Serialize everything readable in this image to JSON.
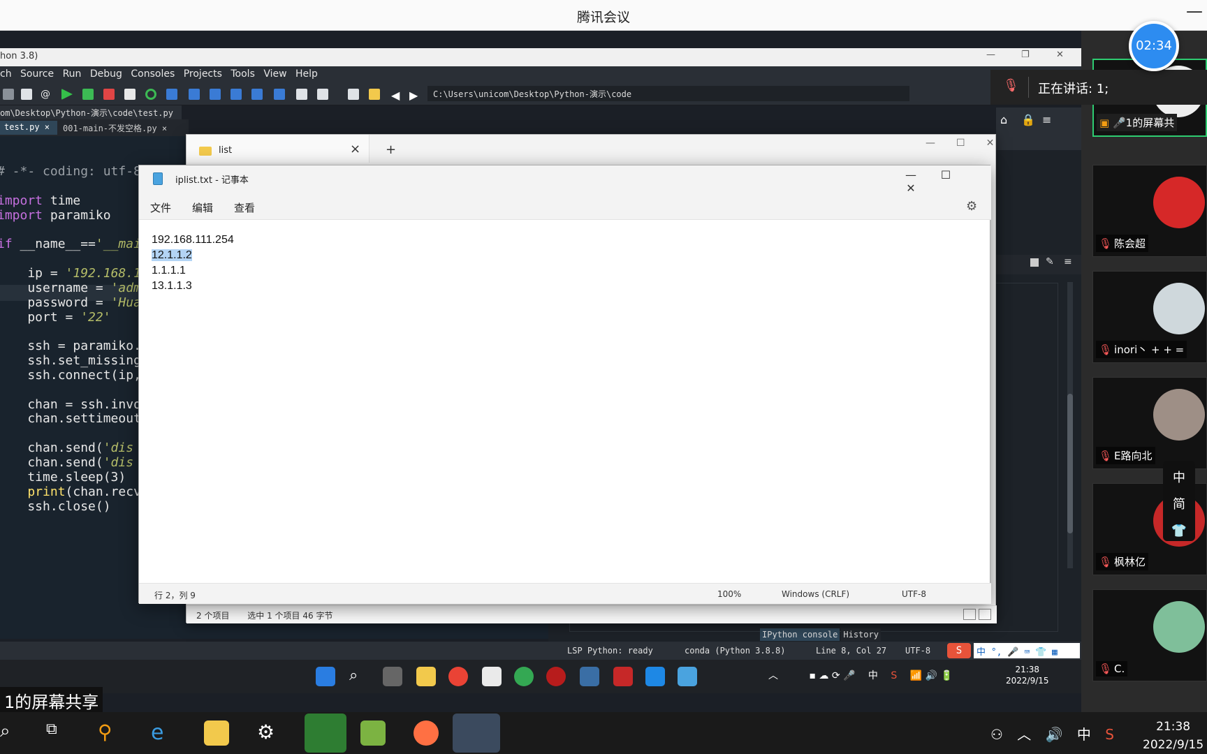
{
  "meeting": {
    "title": "腾讯会议",
    "minimize": "—",
    "timer": "02:34",
    "speaking": "正在讲话: 1;",
    "share_caption": "1的屏幕共享",
    "self_tile_label": "1的屏幕共"
  },
  "participants": [
    {
      "name": "陈会超",
      "avatar_color": "#d62828"
    },
    {
      "name": "inori丶 + + =",
      "avatar_color": "#cfd8dc"
    },
    {
      "name": "E路向北",
      "avatar_color": "#9e8f86"
    },
    {
      "name": "枫林亿",
      "avatar_color": "#c62828"
    },
    {
      "name": "C.",
      "avatar_color": "#7fbf9a"
    }
  ],
  "ime_palette": [
    "中",
    "简",
    "👕"
  ],
  "spyder": {
    "title": "hon 3.8)",
    "menu": [
      "ch",
      "Source",
      "Run",
      "Debug",
      "Consoles",
      "Projects",
      "Tools",
      "View",
      "Help"
    ],
    "path": "C:\\Users\\unicom\\Desktop\\Python-演示\\code",
    "filepath": "om\\Desktop\\Python-演示\\code\\test.py",
    "tabs": [
      "test.py ×",
      "001-main-不发空格.py ×"
    ],
    "code": [
      {
        "text": "# -*- coding: utf-8",
        "cls": "com"
      },
      {
        "text": "",
        "cls": ""
      },
      {
        "text": "import time",
        "cls": "kwline"
      },
      {
        "text": "import paramiko",
        "cls": "kwline"
      },
      {
        "text": "",
        "cls": ""
      },
      {
        "text": "if __name__=='__mai",
        "cls": "ifline"
      },
      {
        "text": "",
        "cls": ""
      },
      {
        "text": "    ip = '192.168.1",
        "cls": "strline"
      },
      {
        "text": "    username = 'adm",
        "cls": "strline"
      },
      {
        "text": "    password = 'Hua",
        "cls": "strline"
      },
      {
        "text": "    port = '22'",
        "cls": "strline"
      },
      {
        "text": "",
        "cls": ""
      },
      {
        "text": "    ssh = paramiko.",
        "cls": ""
      },
      {
        "text": "    ssh.set_missing",
        "cls": ""
      },
      {
        "text": "    ssh.connect(ip,",
        "cls": ""
      },
      {
        "text": "",
        "cls": ""
      },
      {
        "text": "    chan = ssh.invo",
        "cls": ""
      },
      {
        "text": "    chan.settimeout",
        "cls": ""
      },
      {
        "text": "",
        "cls": ""
      },
      {
        "text": "    chan.send('dis",
        "cls": "strline"
      },
      {
        "text": "    chan.send('dis",
        "cls": "strline"
      },
      {
        "text": "    time.sleep(3)",
        "cls": ""
      },
      {
        "text": "    print(chan.recv",
        "cls": "printline"
      },
      {
        "text": "    ssh.close()",
        "cls": ""
      }
    ],
    "console_tabs": [
      "IPython console",
      "History"
    ],
    "status": {
      "lsp": "LSP Python: ready",
      "conda": "conda (Python 3.8.8)",
      "pos": "Line 8, Col 27",
      "enc": "UTF-8"
    }
  },
  "explorer": {
    "tab_title": "list",
    "status": [
      "2 个项目",
      "选中 1 个项目 46 字节"
    ]
  },
  "notepad": {
    "title": "iplist.txt - 记事本",
    "menu": [
      "文件",
      "编辑",
      "查看"
    ],
    "lines": [
      "192.168.111.254",
      "12.1.1.2",
      "1.1.1.1",
      "13.1.1.3"
    ],
    "selected_line": 1,
    "status": {
      "pos": "行 2，列 9",
      "zoom": "100%",
      "eol": "Windows (CRLF)",
      "enc": "UTF-8"
    }
  },
  "inner_taskbar": {
    "ime": "中",
    "clock_time": "21:38",
    "clock_date": "2022/9/15"
  },
  "host_taskbar": {
    "ime": "中",
    "clock_time": "21:38",
    "clock_date": "2022/9/15"
  },
  "colors": {
    "editor_bg": "#19232d",
    "accent_blue": "#2d8cf0",
    "selection": "#b3d4f5"
  }
}
